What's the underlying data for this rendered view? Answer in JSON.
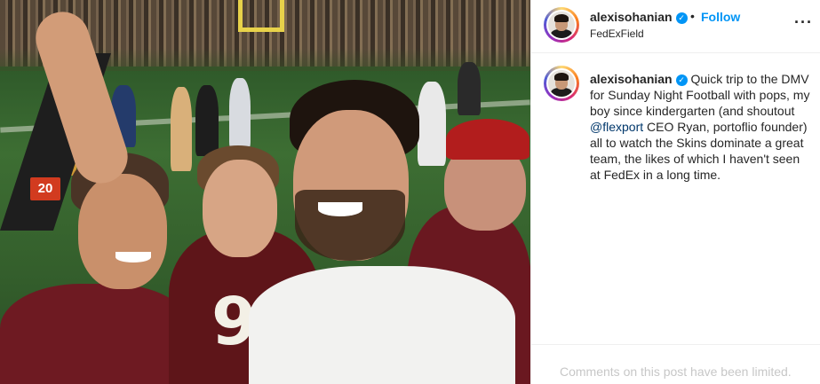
{
  "post": {
    "author": "alexisohanian",
    "verified_icon": "verified-badge-icon",
    "location": "FedExField",
    "follow_label": "Follow",
    "separator": "•",
    "more_label": "···"
  },
  "caption": {
    "author": "alexisohanian",
    "text_before_mention": "Quick trip to the DMV for Sunday Night Football with pops, my boy since kindergarten (and shoutout ",
    "mention": "@flexport",
    "text_after_mention": " CEO Ryan, portoflio founder) all to watch the Skins dominate a great team, the likes of which I haven't seen at FedEx in a long time."
  },
  "photo": {
    "yard_marker": "20",
    "jersey_number": "9"
  },
  "footer": {
    "comments_limited": "Comments on this post have been limited."
  },
  "colors": {
    "accent": "#0095f6",
    "mention": "#00376b",
    "muted": "#c7c7c7",
    "burgundy": "#6e1a22",
    "gold": "#e8d24a"
  }
}
